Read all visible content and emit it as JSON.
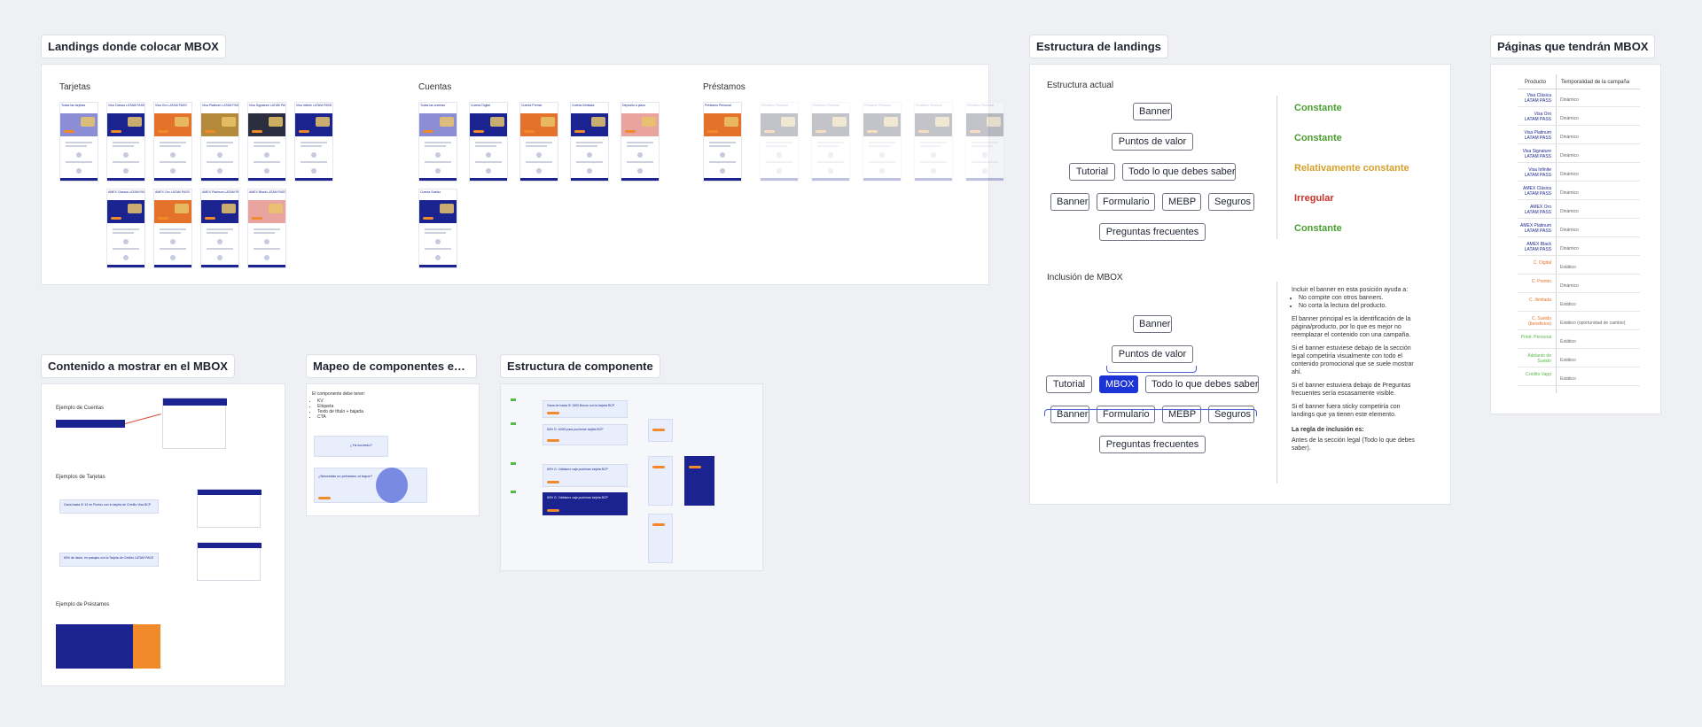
{
  "frames": {
    "landings": {
      "title": "Landings donde colocar MBOX",
      "sections": [
        "Tarjetas",
        "Cuentas",
        "Préstamos"
      ],
      "tarjetas_top": [
        "Todas las tarjetas",
        "Visa Clásica LATAM PASS",
        "Visa Oro LATAM PASS",
        "Visa Platinum LATAM PASS",
        "Visa Signature LATAM PASS",
        "Visa Infinite LATAM PASS"
      ],
      "tarjetas_bottom": [
        "AMEX Clásica LATAM PASS",
        "AMEX Oro LATAM PASS",
        "AMEX Platinum LATAM PASS",
        "AMEX Black LATAM PASS"
      ],
      "cuentas_top": [
        "Todas las cuentas",
        "Cuenta Digital",
        "Cuenta Premio",
        "Cuenta Ilimitada",
        "Depósito a plazo"
      ],
      "cuentas_bottom": [
        "Cuenta Sueldo"
      ],
      "prestamos": [
        "Préstamo Personal"
      ]
    },
    "estructura": {
      "title": "Estructura de landings",
      "actual_label": "Estructura actual",
      "inclusion_label": "Inclusión de MBOX",
      "rows_actual": {
        "r1": [
          "Banner"
        ],
        "r2": [
          "Puntos de valor"
        ],
        "r3": [
          "Tutorial",
          "Todo lo que debes saber"
        ],
        "r4": [
          "Banner",
          "Formulario",
          "MEBP",
          "Seguros"
        ],
        "r5": [
          "Preguntas frecuentes"
        ]
      },
      "status": [
        "Constante",
        "Constante",
        "Relativamente constante",
        "Irregular",
        "Constante"
      ],
      "status_colors": [
        "#4a9e2f",
        "#4a9e2f",
        "#d4a12a",
        "#c8322a",
        "#4a9e2f"
      ],
      "rows_inclusion": {
        "r1": [
          "Banner"
        ],
        "r2": [
          "Puntos de valor"
        ],
        "r3": [
          "Tutorial",
          "MBOX",
          "Todo lo que debes saber"
        ],
        "r4": [
          "Banner",
          "Formulario",
          "MEBP",
          "Seguros"
        ],
        "r5": [
          "Preguntas frecuentes"
        ]
      },
      "notes": {
        "intro": "Incluir el banner en esta posición ayuda a:",
        "bullets": [
          "No compite con otros banners.",
          "No corta la lectura del producto."
        ],
        "p1": "El banner principal es la identificación de la página/producto, por lo que es mejor no reemplazar el contenido con una campaña.",
        "p2": "Si el banner estuviese debajo de la sección legal competiría visualmente con todo el contenido promocional que se suele mostrar ahí.",
        "p3": "Si el banner estuviera debajo de Preguntas frecuentes sería escasamente visible.",
        "p4": "Si el banner fuera sticky competiría con landings que ya tienen este elemento.",
        "rule_title": "La regla de inclusión es:",
        "rule": "Antes de la sección legal (Todo lo que debes saber)."
      }
    },
    "paginas": {
      "title": "Páginas que tendrán MBOX",
      "col_product": "Producto",
      "col_temp": "Temporalidad de la campaña",
      "rows": [
        {
          "name": "Visa Clásica LATAM PASS",
          "temp": "Dinámico",
          "color": "#1e2a8f"
        },
        {
          "name": "Visa Oro LATAM PASS",
          "temp": "Dinámico",
          "color": "#1e2a8f"
        },
        {
          "name": "Visa Platinum LATAM PASS",
          "temp": "Dinámico",
          "color": "#1e2a8f"
        },
        {
          "name": "Visa Signature LATAM PASS",
          "temp": "Dinámico",
          "color": "#1e2a8f"
        },
        {
          "name": "Visa Infinite LATAM PASS",
          "temp": "Dinámico",
          "color": "#1e2a8f"
        },
        {
          "name": "AMEX Clásica LATAM PASS",
          "temp": "Dinámico",
          "color": "#1e2a8f"
        },
        {
          "name": "AMEX Oro LATAM PASS",
          "temp": "Dinámico",
          "color": "#1e2a8f"
        },
        {
          "name": "AMEX Platinum LATAM PASS",
          "temp": "Dinámico",
          "color": "#1e2a8f"
        },
        {
          "name": "AMEX Black LATAM PASS",
          "temp": "Dinámico",
          "color": "#1e2a8f"
        },
        {
          "name": "C. Digital",
          "temp": "Estático",
          "color": "#e4722b"
        },
        {
          "name": "C. Premio",
          "temp": "Dinámico",
          "color": "#e4722b"
        },
        {
          "name": "C. Ilimitada",
          "temp": "Estático",
          "color": "#e4722b"
        },
        {
          "name": "C. Sueldo (beneficios)",
          "temp": "Estático (oportunidad de cambio)",
          "color": "#e4722b"
        },
        {
          "name": "Prést. Personal",
          "temp": "Estático",
          "color": "#58b848"
        },
        {
          "name": "Adelanto de Sueldo",
          "temp": "Estático",
          "color": "#58b848"
        },
        {
          "name": "Crédito Vapp",
          "temp": "Estático",
          "color": "#58b848"
        }
      ]
    },
    "contenido": {
      "title": "Contenido a mostrar en el MBOX",
      "labels": [
        "Ejemplo de Cuentas",
        "Ejemplos de Tarjetas",
        "Ejemplo de Préstamos"
      ]
    },
    "mapeo": {
      "title": "Mapeo de componentes existentes",
      "intro": "El componente debe tener:",
      "items": [
        "KV",
        "Etiqueta",
        "Texto de título + bajada",
        "CTA"
      ],
      "q1": "¿Ya ocurrido?",
      "q2": "¿Necesitas un préstamo al toque?"
    },
    "estructura_comp": {
      "title": "Estructura de componente",
      "banners": [
        "Gana de hasta S/ 1500 Bonos con tu tarjeta BCP",
        "60% G. 40/60 para pucheras tarjeta BCP",
        "60% G. Válidamo caja pucheras tarjeta BCP",
        "60% G. Válidamo caja pucheras tarjeta BCP"
      ]
    }
  }
}
